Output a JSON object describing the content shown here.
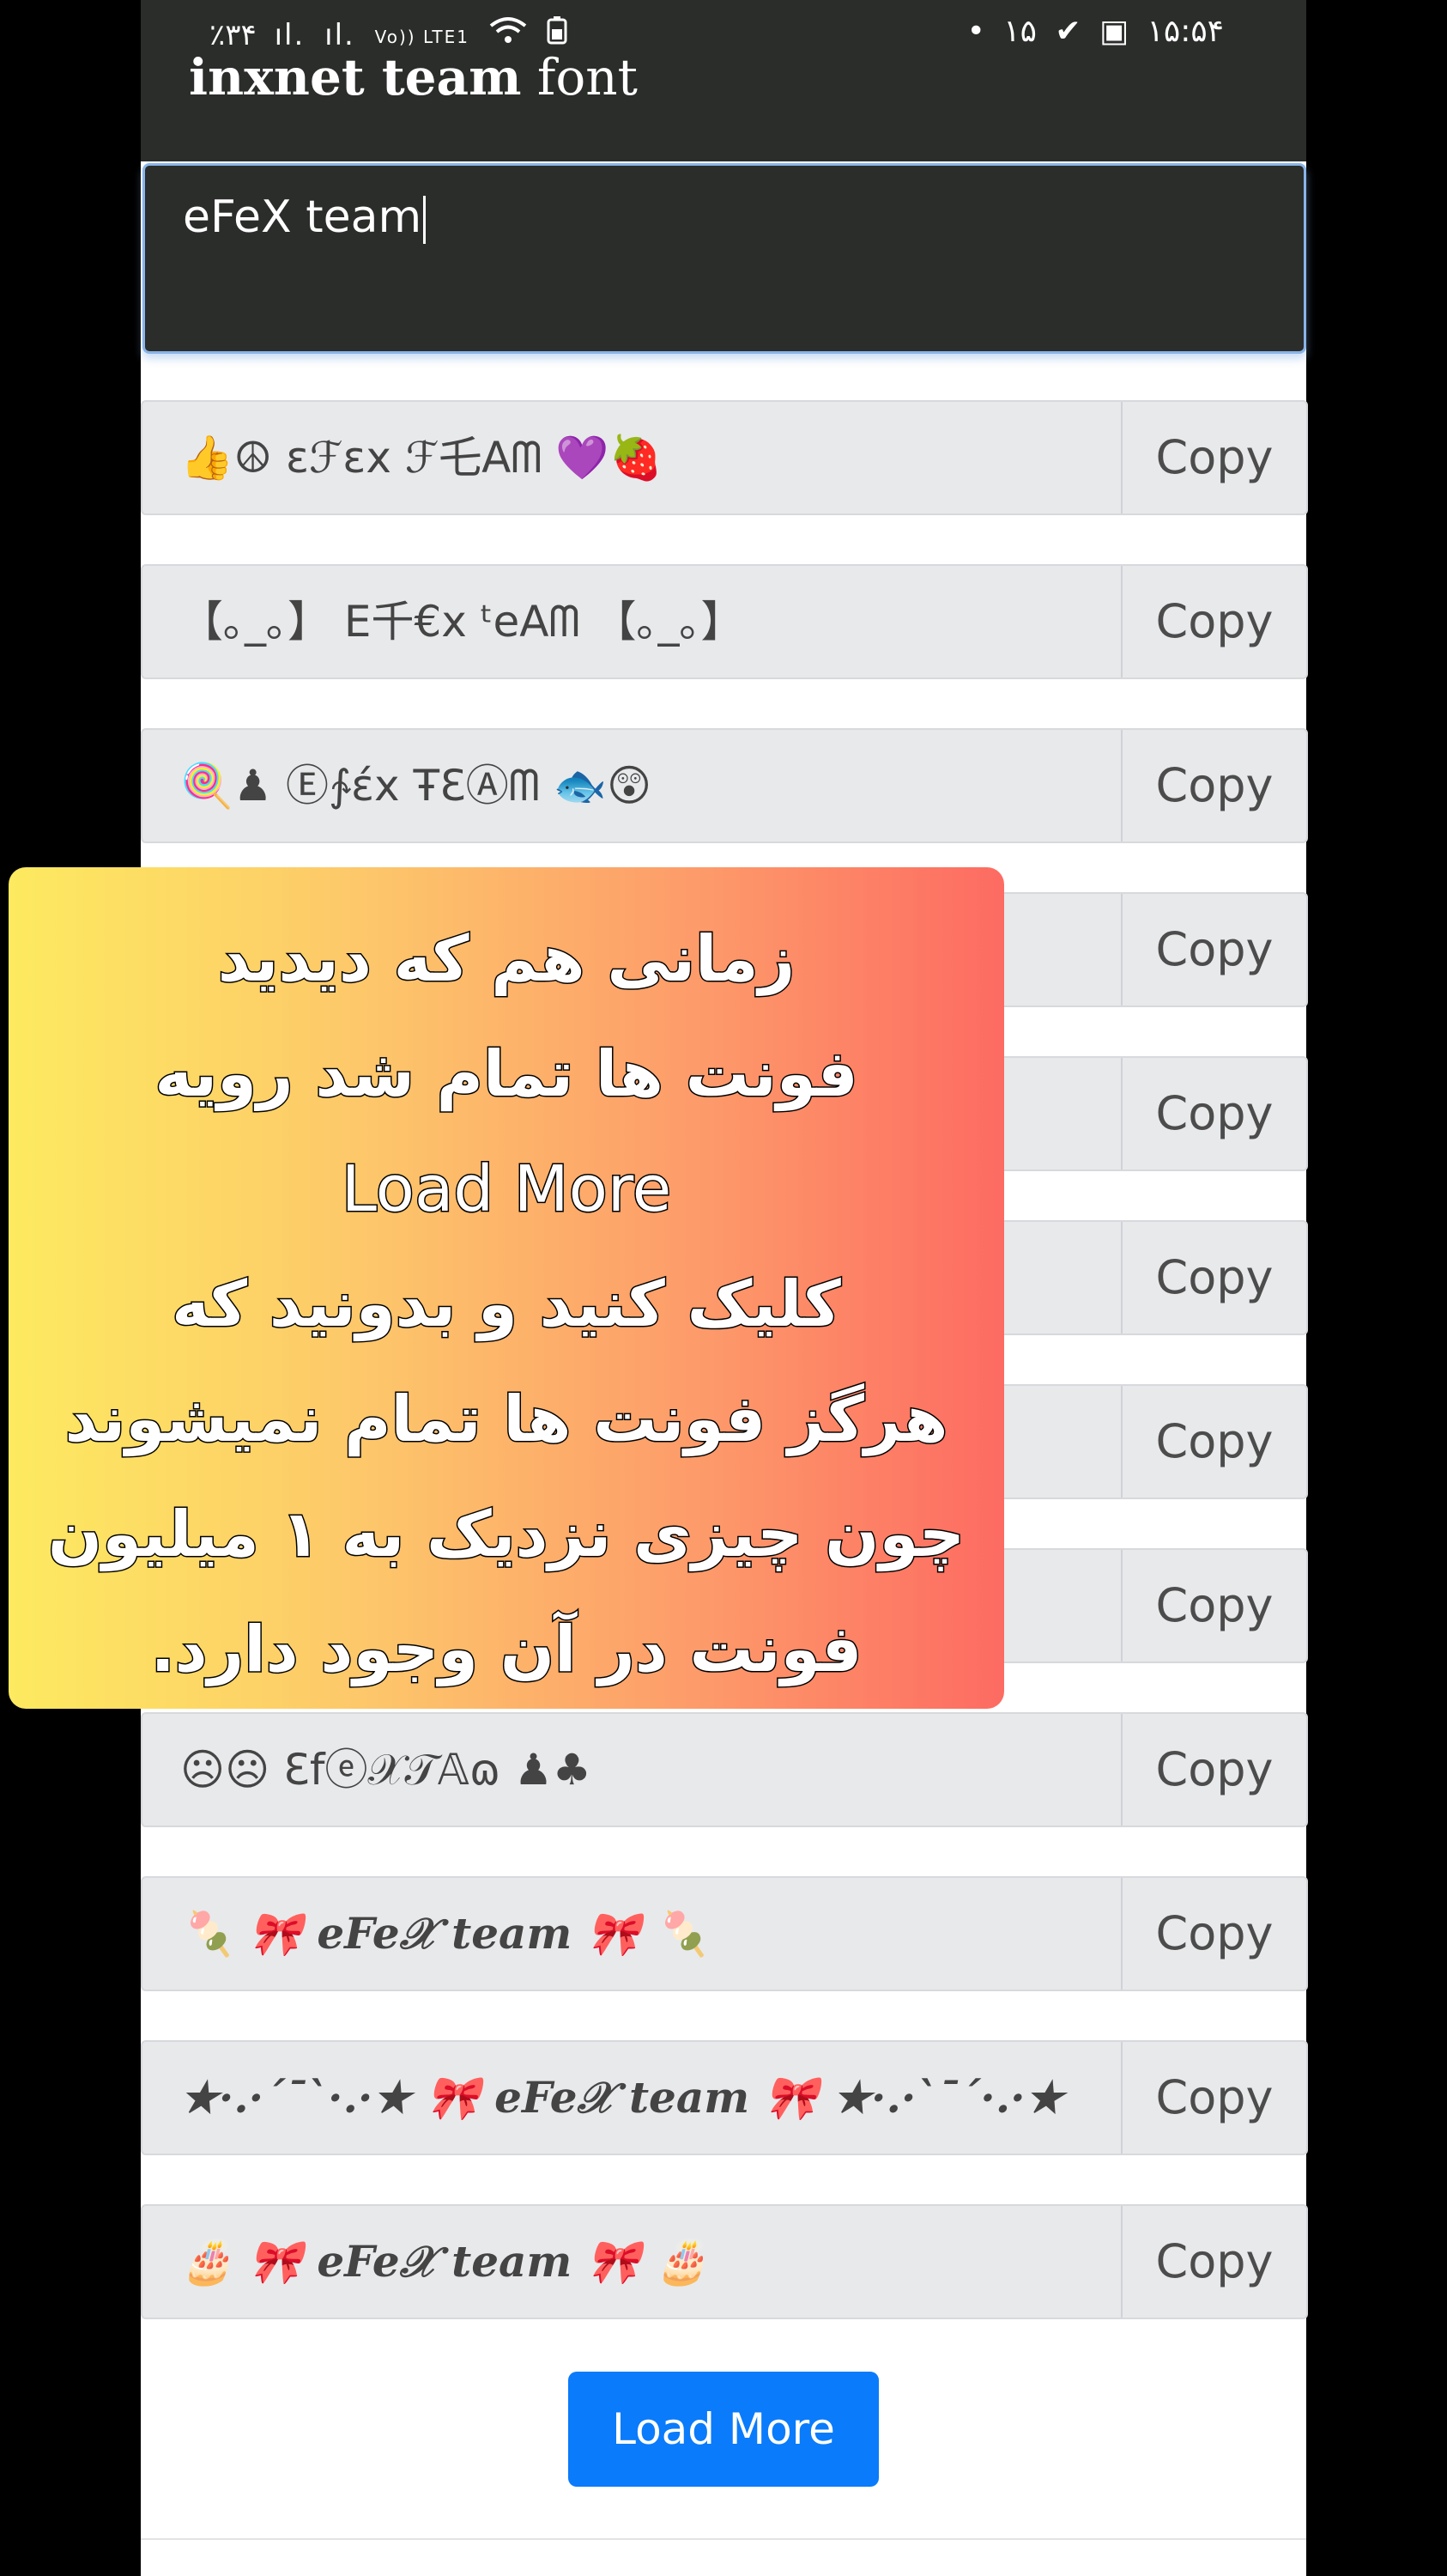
{
  "status_bar": {
    "left": [
      "٪۳۴",
      "ıl.",
      "ıl.",
      "Vo)) LTE1",
      "wifi",
      "battery"
    ],
    "right": [
      "•",
      "۱۵",
      "✔",
      "▣",
      "۱۵:۵۴"
    ]
  },
  "app": {
    "title_bold": "inxnet team",
    "title_rest": " font"
  },
  "input": {
    "value": "eFeX team"
  },
  "rows": [
    {
      "text": "👍☮ εℱεx ℱ乇Aᗰ 💜🍓",
      "copy": "Copy"
    },
    {
      "text": "【｡_｡】 E千€x ᵗeAᗰ 【｡_｡】",
      "copy": "Copy"
    },
    {
      "text": "🍭♟ Ⓔ∱έx ŦƐⒶᗰ 🐟😲",
      "copy": "Copy"
    },
    {
      "text": "",
      "copy": "Copy"
    },
    {
      "text": "",
      "copy": "Copy"
    },
    {
      "text": "",
      "copy": "Copy"
    },
    {
      "text": "",
      "copy": "Copy"
    },
    {
      "text": "",
      "copy": "Copy"
    },
    {
      "text": "☹☹ Ɛfⓔ𝒳𝒯𝔸ɷ ♟♣",
      "copy": "Copy"
    },
    {
      "text": "🍡 🎀 eFe𝒳 team 🎀 🍡",
      "copy": "Copy",
      "style": "cursive"
    },
    {
      "text": "★·.·´¯`·.·★ 🎀 eFe𝒳 team 🎀 ★·.·`¯´·.·★",
      "copy": "Copy",
      "style": "cursive"
    },
    {
      "text": "🎂 🎀 eFe𝒳 team 🎀 🎂",
      "copy": "Copy",
      "style": "cursive"
    }
  ],
  "load_more": "Load More",
  "overlay": {
    "lines": [
      "زمانی هم که دیدید",
      "فونت ها تمام شد رویه",
      "Load More",
      "کلیک کنید و بدونید که",
      "هرگز فونت ها تمام نمیشوند",
      "چون چیزی نزدیک به ۱ میلیون",
      "فونت در آن وجود دارد."
    ]
  },
  "colors": {
    "header_bg": "#2b2d2b",
    "row_bg": "#e8e9eb",
    "button_blue": "#0a7bfb",
    "overlay_gradient": [
      "#fdea60",
      "#fd6b62"
    ]
  }
}
